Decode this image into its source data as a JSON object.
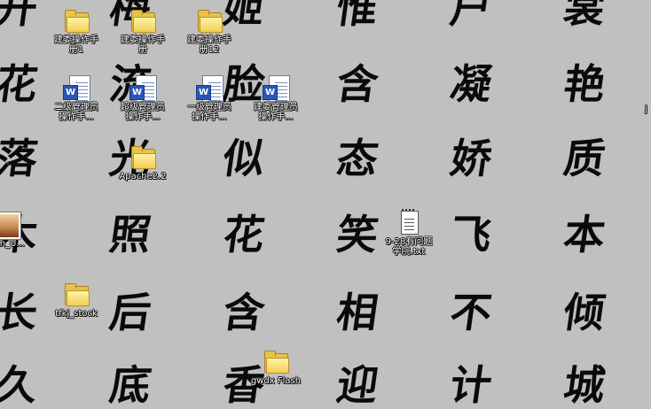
{
  "wallpaper": {
    "background": "#c0c0c0",
    "rows": [
      [
        "开",
        "梅",
        "姬",
        "惟",
        "户",
        "裳"
      ],
      [
        "花",
        "流",
        "脸",
        "含",
        "凝",
        "艳"
      ],
      [
        "落",
        "光",
        "似",
        "态",
        "娇",
        "质"
      ],
      [
        "木",
        "照",
        "花",
        "笑",
        "飞",
        "本"
      ],
      [
        "长",
        "后",
        "含",
        "相",
        "不",
        "倾"
      ],
      [
        "久",
        "底",
        "香",
        "迎",
        "计",
        "城"
      ]
    ]
  },
  "icons": [
    {
      "label": "建委操作手\n册1",
      "icon": "folder-icon"
    },
    {
      "label": "建委操作手\n册",
      "icon": "folder-icon"
    },
    {
      "label": "建委操作手\n册12",
      "icon": "folder-icon"
    },
    {
      "label": "二级管理员\n操作手...",
      "icon": "word-document-icon",
      "badge": "W"
    },
    {
      "label": "超级管理员\n操作手...",
      "icon": "word-document-icon",
      "badge": "W"
    },
    {
      "label": "一级管理员\n操作手...",
      "icon": "word-document-icon",
      "badge": "W"
    },
    {
      "label": "建委管理员\n操作手...",
      "icon": "word-document-icon",
      "badge": "W"
    },
    {
      "label": "Apache2.2",
      "icon": "folder-icon"
    },
    {
      "label": "om_U...",
      "icon": "image-file-icon"
    },
    {
      "label": "9-28有问题\n学院.txt",
      "icon": "text-file-icon"
    },
    {
      "label": "tfkj_stock",
      "icon": "folder-icon"
    },
    {
      "label": "gwdx  Flash",
      "icon": "folder-icon"
    }
  ],
  "edge_fragment": "j"
}
